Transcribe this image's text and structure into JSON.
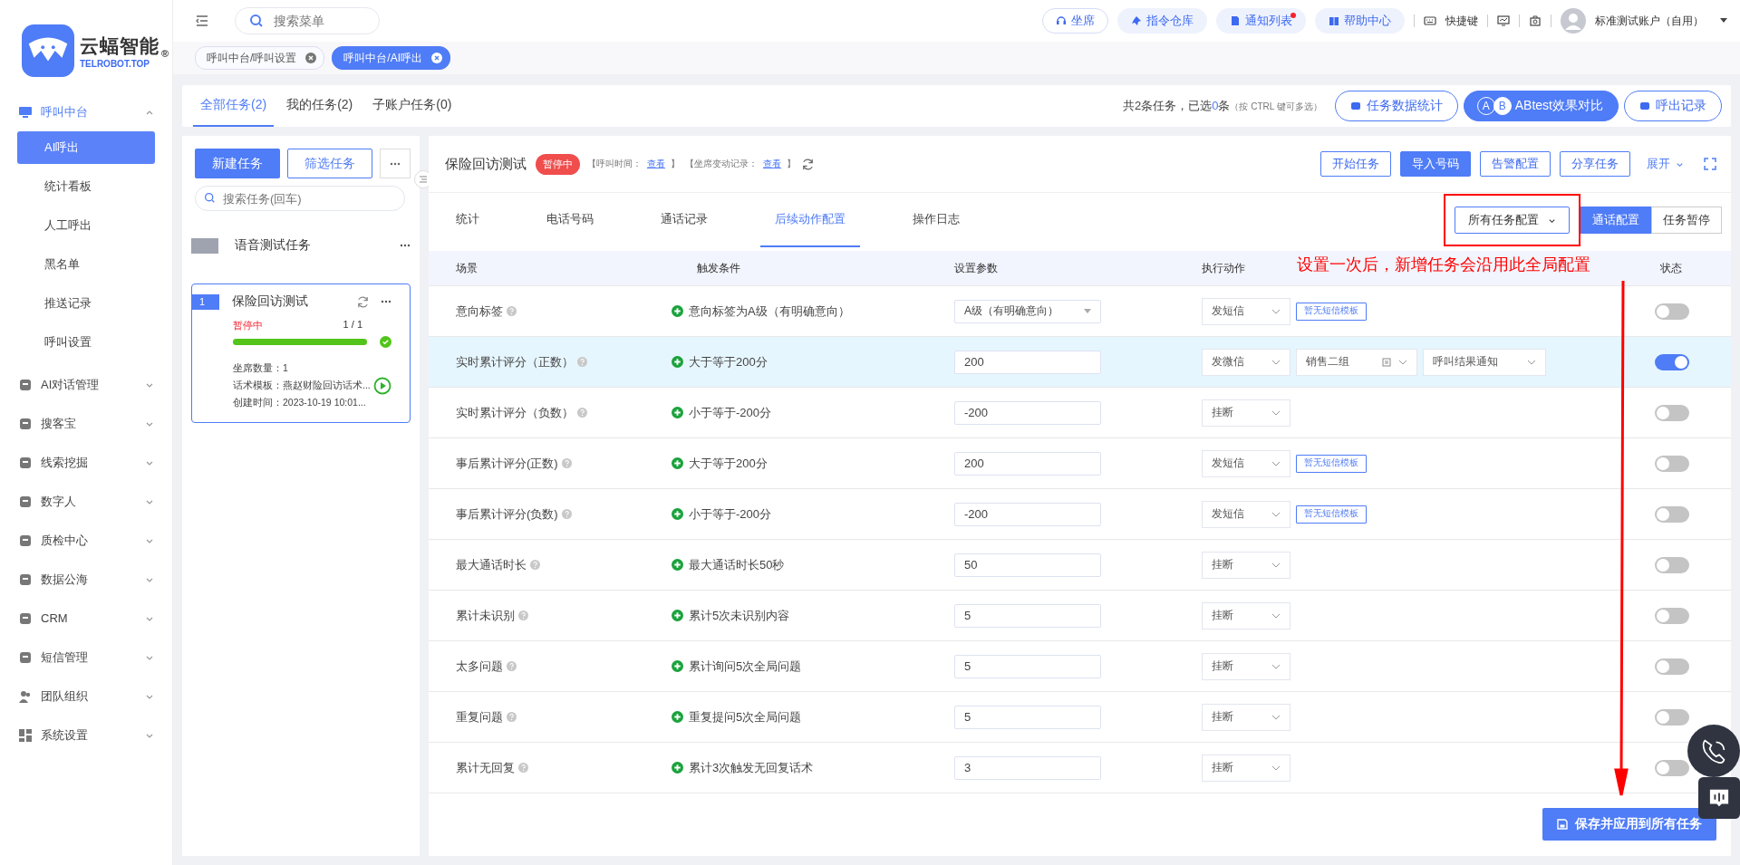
{
  "brand": {
    "name": "云蝠智能",
    "mark": "®",
    "domain": "TELROBOT.TOP"
  },
  "topbar": {
    "search_placeholder": "搜索菜单",
    "buttons": [
      {
        "label": "坐席",
        "kind": "outline",
        "dot": false
      },
      {
        "label": "指令仓库",
        "kind": "soft",
        "dot": false
      },
      {
        "label": "通知列表",
        "kind": "soft",
        "dot": true
      },
      {
        "label": "帮助中心",
        "kind": "soft",
        "dot": false
      }
    ],
    "shortcut": "快捷键",
    "user": "标准测试账户（自用）"
  },
  "tags": [
    {
      "label": "呼叫中台/呼叫设置",
      "selected": false
    },
    {
      "label": "呼叫中台/AI呼出",
      "selected": true
    }
  ],
  "sidebar": {
    "items": [
      {
        "label": "呼叫中台",
        "expanded": true,
        "children": [
          {
            "label": "AI呼出",
            "selected": true
          },
          {
            "label": "统计看板",
            "selected": false
          },
          {
            "label": "人工呼出",
            "selected": false
          },
          {
            "label": "黑名单",
            "selected": false
          },
          {
            "label": "推送记录",
            "selected": false
          },
          {
            "label": "呼叫设置",
            "selected": false
          }
        ]
      },
      {
        "label": "AI对话管理",
        "expanded": false
      },
      {
        "label": "搜客宝",
        "expanded": false
      },
      {
        "label": "线索挖掘",
        "expanded": false
      },
      {
        "label": "数字人",
        "expanded": false
      },
      {
        "label": "质检中心",
        "expanded": false
      },
      {
        "label": "数据公海",
        "expanded": false
      },
      {
        "label": "CRM",
        "expanded": false
      },
      {
        "label": "短信管理",
        "expanded": false
      },
      {
        "label": "团队组织",
        "expanded": false
      },
      {
        "label": "系统设置",
        "expanded": false
      }
    ]
  },
  "main_tabs": [
    {
      "label": "全部任务(2)",
      "selected": true
    },
    {
      "label": "我的任务(2)",
      "selected": false
    },
    {
      "label": "子账户任务(0)",
      "selected": false
    }
  ],
  "selection": {
    "prefix": "共2条任务，已选",
    "count": "0",
    "suffix": "条",
    "hint": "（按 CTRL 键可多选）"
  },
  "toolbar_buttons": [
    {
      "label": "任务数据统计",
      "kind": "outline"
    },
    {
      "label": "ABtest效果对比",
      "kind": "ab"
    },
    {
      "label": "呼出记录",
      "kind": "outline"
    }
  ],
  "ab_letters": [
    "A",
    "B"
  ],
  "task_panel": {
    "new_button": "新建任务",
    "filter_button": "筛选任务",
    "search_placeholder": "搜索任务(回车)",
    "groups": [
      {
        "name": "语音测试任务"
      }
    ],
    "tasks": [
      {
        "index": "1",
        "name": "保险回访测试",
        "status": "暂停中",
        "progress": "1 / 1",
        "level": 1,
        "done": true,
        "seats": "坐席数量：1",
        "template": "话术模板：燕赵财险回访话术...",
        "created": "创建时间：2023-10-19 10:01...",
        "selected": true
      }
    ]
  },
  "detail": {
    "title": "保险回访测试",
    "status": "暂停中",
    "meta": [
      {
        "label": "【呼叫时间：",
        "link": "查看",
        "end": "】"
      },
      {
        "label": "【坐席变动记录：",
        "link": "查看",
        "end": "】"
      }
    ],
    "actions": [
      {
        "label": "开始任务",
        "kind": "outline"
      },
      {
        "label": "导入号码",
        "kind": "primary"
      },
      {
        "label": "告警配置",
        "kind": "outline"
      },
      {
        "label": "分享任务",
        "kind": "outline"
      },
      {
        "label": "展开",
        "kind": "link"
      }
    ],
    "sub_tabs": [
      {
        "label": "统计",
        "selected": false
      },
      {
        "label": "电话号码",
        "selected": false
      },
      {
        "label": "通话记录",
        "selected": false
      },
      {
        "label": "后续动作配置",
        "selected": true
      },
      {
        "label": "操作日志",
        "selected": false
      }
    ],
    "config_select": "所有任务配置",
    "segments": [
      {
        "label": "通话配置",
        "selected": true
      },
      {
        "label": "任务暂停",
        "selected": false
      }
    ]
  },
  "table": {
    "columns": [
      "场景",
      "触发条件",
      "设置参数",
      "执行动作",
      "状态"
    ],
    "rows": [
      {
        "scene": "意向标签",
        "condition": "意向标签为A级（有明确意向）",
        "param": {
          "kind": "select",
          "value": "A级（有明确意向）"
        },
        "actions": [
          {
            "kind": "select",
            "value": "发短信"
          },
          {
            "kind": "tag",
            "value": "暂无短信模板"
          }
        ],
        "on": false,
        "selected": false
      },
      {
        "scene": "实时累计评分（正数）",
        "condition": "大于等于200分",
        "param": {
          "kind": "input",
          "value": "200"
        },
        "actions": [
          {
            "kind": "select",
            "value": "发微信"
          },
          {
            "kind": "group-select",
            "value": "销售二组"
          },
          {
            "kind": "wide-select",
            "value": "呼叫结果通知"
          }
        ],
        "on": true,
        "selected": true
      },
      {
        "scene": "实时累计评分（负数）",
        "condition": "小于等于-200分",
        "param": {
          "kind": "input",
          "value": "-200"
        },
        "actions": [
          {
            "kind": "select",
            "value": "挂断"
          }
        ],
        "on": false,
        "selected": false
      },
      {
        "scene": "事后累计评分(正数)",
        "condition": "大于等于200分",
        "param": {
          "kind": "input",
          "value": "200"
        },
        "actions": [
          {
            "kind": "select",
            "value": "发短信"
          },
          {
            "kind": "tag",
            "value": "暂无短信模板"
          }
        ],
        "on": false,
        "selected": false
      },
      {
        "scene": "事后累计评分(负数)",
        "condition": "小于等于-200分",
        "param": {
          "kind": "input",
          "value": "-200"
        },
        "actions": [
          {
            "kind": "select",
            "value": "发短信"
          },
          {
            "kind": "tag",
            "value": "暂无短信模板"
          }
        ],
        "on": false,
        "selected": false
      },
      {
        "scene": "最大通话时长",
        "condition": "最大通话时长50秒",
        "param": {
          "kind": "input",
          "value": "50"
        },
        "actions": [
          {
            "kind": "select",
            "value": "挂断"
          }
        ],
        "on": false,
        "selected": false
      },
      {
        "scene": "累计未识别",
        "condition": "累计5次未识别内容",
        "param": {
          "kind": "input",
          "value": "5"
        },
        "actions": [
          {
            "kind": "select",
            "value": "挂断"
          }
        ],
        "on": false,
        "selected": false
      },
      {
        "scene": "太多问题",
        "condition": "累计询问5次全局问题",
        "param": {
          "kind": "input",
          "value": "5"
        },
        "actions": [
          {
            "kind": "select",
            "value": "挂断"
          }
        ],
        "on": false,
        "selected": false
      },
      {
        "scene": "重复问题",
        "condition": "重复提问5次全局问题",
        "param": {
          "kind": "input",
          "value": "5"
        },
        "actions": [
          {
            "kind": "select",
            "value": "挂断"
          }
        ],
        "on": false,
        "selected": false
      },
      {
        "scene": "累计无回复",
        "condition": "累计3次触发无回复话术",
        "param": {
          "kind": "input",
          "value": "3"
        },
        "actions": [
          {
            "kind": "select",
            "value": "挂断"
          }
        ],
        "on": false,
        "selected": false
      }
    ]
  },
  "save_button": "保存并应用到所有任务",
  "annotation": {
    "text": "设置一次后，新增任务会沿用此全局配置"
  }
}
